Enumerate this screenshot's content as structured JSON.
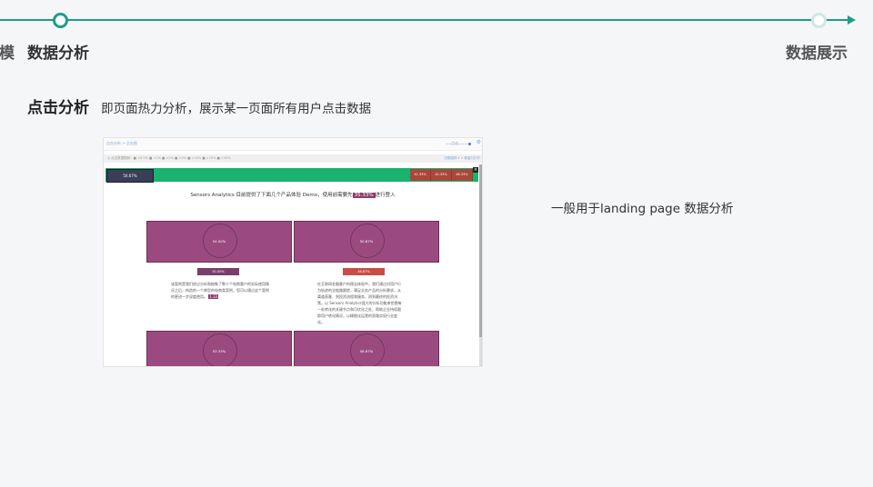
{
  "nav": {
    "steps": [
      {
        "label": "模"
      },
      {
        "label": "数据分析"
      },
      {
        "label": "数据展示"
      }
    ]
  },
  "section": {
    "title": "点击分析",
    "description": "即页面热力分析，展示某一页面所有用户点击数据"
  },
  "note": "一般用于landing page 数据分析",
  "colors": {
    "accent": "#1f9c86",
    "heat_green": "#19b26e",
    "heat_purple": "#9b4a7f",
    "heat_red": "#a9473a"
  },
  "screenshot": {
    "breadcrumb": "点击分析  >  点击图",
    "zoom_label": "点击",
    "legend": "◎ 点击数据图例：■ >0.5%  ■ >1%  ■ >2%  ■ >5%  ■ >10%  ■ >20%  ■ >30%",
    "legend_right": "日期选择 ▾   ↗ 新窗口打开",
    "hero_left_pct": "50.67%",
    "hero_right_pcts": [
      "41.33%",
      "42.33%",
      "46.33%"
    ],
    "headline_text": "Sensors Analytics 目前提供了下面几个产品体验 Demo，使用前需要先",
    "headline_pct": "35.33%",
    "headline_suffix": "进行登入",
    "cards": [
      {
        "pct": "54.00%"
      },
      {
        "pct": "50.67%"
      },
      {
        "pct": "53.33%"
      },
      {
        "pct": "58.67%"
      }
    ],
    "pills": [
      "50.00%",
      "46.67%"
    ],
    "para1": "该案例是我们经过分析和抽象了数十个电商客户的实际使用情况之后，构造的一个典型的电商类案例，您可以通过这个案例的更进一步深度使用。",
    "para1_badge": "1.33",
    "para2": "在互联网金融客户的理念体现中，我们通过对用户行为轨迹的全链路跟踪，满足业务产品的分析需求。从渠道获客、到投资流程和服务，再到最终的投资决策。以 Sensors Analytics强大的分析功能来挖掘每一处转化的关键节点和可优化之处，帮助企业持续跟踪用户转化情况，以精细化运营的思路实现行业变化。"
  }
}
